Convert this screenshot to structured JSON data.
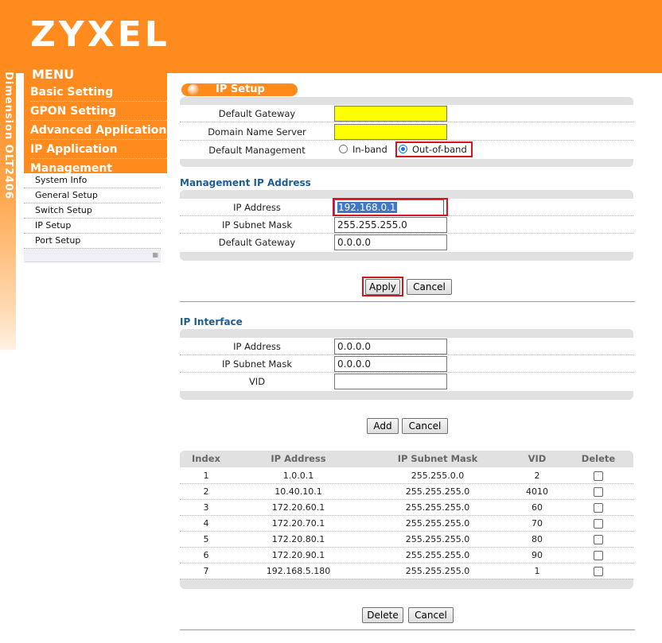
{
  "brand": {
    "logo": "ZYXEL",
    "product": "Dimension OLT2406"
  },
  "colors": {
    "brand_orange": "#ff8b1e",
    "highlight_yellow": "#ffff00",
    "heading_blue": "#1f5d97",
    "callout_red": "#d7141d"
  },
  "menu": {
    "title": "MENU",
    "items": [
      "Basic Setting",
      "GPON Setting",
      "Advanced Application",
      "IP Application",
      "Management"
    ],
    "submenu": [
      "System Info",
      "General Setup",
      "Switch Setup",
      "IP Setup",
      "Port Setup"
    ]
  },
  "page_title": "IP Setup",
  "general": {
    "default_gateway_label": "Default Gateway",
    "default_gateway_value": "",
    "dns_label": "Domain Name Server",
    "dns_value": "",
    "mgmt_label": "Default Management",
    "option_inband": "In-band",
    "option_outofband": "Out-of-band",
    "selected": "Out-of-band"
  },
  "management_ip": {
    "heading": "Management IP Address",
    "ip_label": "IP Address",
    "ip_value": "192.168.0.1",
    "mask_label": "IP Subnet Mask",
    "mask_value": "255.255.255.0",
    "gw_label": "Default Gateway",
    "gw_value": "0.0.0.0",
    "apply_label": "Apply",
    "cancel_label": "Cancel"
  },
  "ip_interface": {
    "heading": "IP Interface",
    "ip_label": "IP Address",
    "ip_value": "0.0.0.0",
    "mask_label": "IP Subnet Mask",
    "mask_value": "0.0.0.0",
    "vid_label": "VID",
    "vid_value": "",
    "add_label": "Add",
    "cancel_label": "Cancel"
  },
  "table": {
    "columns": [
      "Index",
      "IP Address",
      "IP Subnet Mask",
      "VID",
      "Delete"
    ],
    "rows": [
      {
        "index": "1",
        "ip": "1.0.0.1",
        "mask": "255.255.0.0",
        "vid": "2"
      },
      {
        "index": "2",
        "ip": "10.40.10.1",
        "mask": "255.255.255.0",
        "vid": "4010"
      },
      {
        "index": "3",
        "ip": "172.20.60.1",
        "mask": "255.255.255.0",
        "vid": "60"
      },
      {
        "index": "4",
        "ip": "172.20.70.1",
        "mask": "255.255.255.0",
        "vid": "70"
      },
      {
        "index": "5",
        "ip": "172.20.80.1",
        "mask": "255.255.255.0",
        "vid": "80"
      },
      {
        "index": "6",
        "ip": "172.20.90.1",
        "mask": "255.255.255.0",
        "vid": "90"
      },
      {
        "index": "7",
        "ip": "192.168.5.180",
        "mask": "255.255.255.0",
        "vid": "1"
      }
    ],
    "delete_label": "Delete",
    "cancel_label": "Cancel"
  }
}
